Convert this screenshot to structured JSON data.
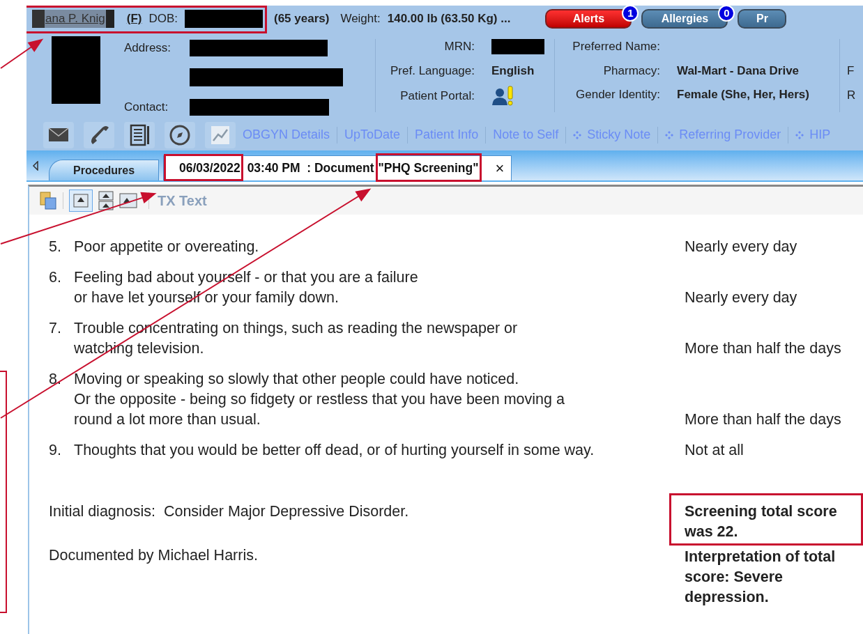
{
  "header": {
    "patient_name": "ana P. Knig",
    "sex": "(F)",
    "dob_label": "DOB:",
    "age": "(65 years)",
    "weight_label": "Weight:",
    "weight": "140.00 lb (63.50 Kg) ...",
    "badges": [
      {
        "label": "Alerts",
        "count": "1",
        "kind": "alert"
      },
      {
        "label": "Allergies",
        "count": "0",
        "kind": "normal"
      },
      {
        "label": "Pr",
        "kind": "normal"
      }
    ]
  },
  "details": {
    "address_label": "Address:",
    "contact_label": "Contact:",
    "mrn_label": "MRN:",
    "language_label": "Pref. Language:",
    "language": "English",
    "portal_label": "Patient Portal:",
    "preferred_name_label": "Preferred Name:",
    "pharmacy_label": "Pharmacy:",
    "pharmacy": "Wal-Mart - Dana Drive",
    "gender_label": "Gender Identity:",
    "gender": "Female (She, Her, Hers)",
    "column_4": [
      "F",
      "R"
    ]
  },
  "toolbar": {
    "links": [
      {
        "label": "OBGYN Details",
        "bullet": false
      },
      {
        "label": "UpToDate",
        "bullet": false
      },
      {
        "label": "Patient Info",
        "bullet": false
      },
      {
        "label": "Note to Self",
        "bullet": false
      },
      {
        "label": "Sticky Note",
        "bullet": true
      },
      {
        "label": "Referring Provider",
        "bullet": true
      },
      {
        "label": "HIP",
        "bullet": true
      }
    ]
  },
  "tabs": [
    {
      "label": "Procedures",
      "selected": false
    },
    {
      "date": "06/03/2022",
      "label": "03:40 PM  : Document",
      "title": "\"PHQ Screening\"",
      "close": "×",
      "selected": true
    }
  ],
  "document": {
    "toolbar_label": "TX Text",
    "questions": [
      {
        "number": "5.",
        "text": "Poor appetite or overeating.",
        "answer": "Nearly every day"
      },
      {
        "number": "6.",
        "text": "Feeling bad about yourself - or that you are a failure\n or have let yourself or your family down.",
        "answer": "Nearly every day"
      },
      {
        "number": "7.",
        "text": "Trouble concentrating on things, such as reading the newspaper or\n watching television.",
        "answer": "More than half the days"
      },
      {
        "number": "8.",
        "text": "Moving or speaking so slowly that other people could have noticed.\nOr the opposite - being so fidgety or restless that you have been moving a\nround a lot more than usual.",
        "answer": "More than half the days"
      },
      {
        "number": "9.",
        "text": "Thoughts that you would be better off dead, or of hurting yourself in some way.",
        "answer": "Not at all"
      }
    ],
    "diagnosis": "Initial diagnosis:  Consider Major Depressive Disorder.",
    "documented_by": "Documented by Michael Harris.",
    "score": "Screening total score was 22.",
    "interpretation": "Interpretation of total score: Severe depression."
  }
}
